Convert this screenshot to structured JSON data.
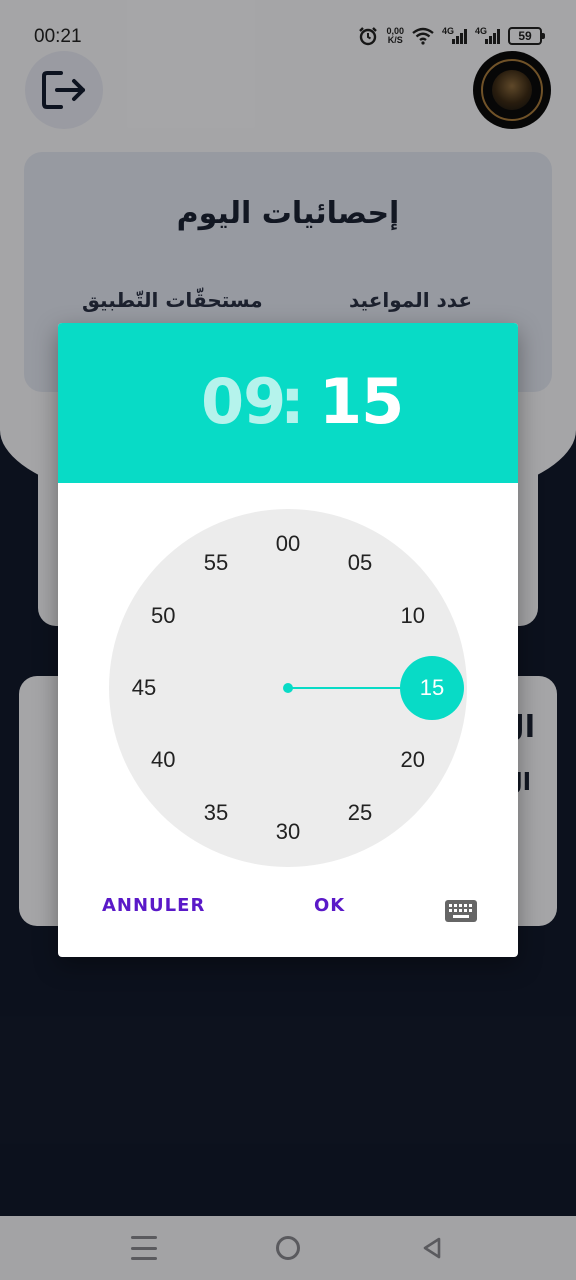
{
  "status_bar": {
    "time": "00:21",
    "net_speed_value": "0,00",
    "net_speed_unit": "K/S",
    "network_1": "4G",
    "network_2": "4G",
    "battery": "59",
    "icons": [
      "alarm-icon",
      "wifi-icon",
      "signal-icon",
      "signal-icon",
      "battery-icon"
    ]
  },
  "header": {
    "logout_icon": "logout-icon",
    "avatar_icon": "profile-avatar"
  },
  "stats_card": {
    "title": "إحصائيات اليوم",
    "label_appointments": "عدد المواعيد",
    "label_dues": "مستحقّات التّطبيق"
  },
  "card_c": {
    "char1": "ال",
    "char2": "ال"
  },
  "time_picker": {
    "hour": "09",
    "separator": ":",
    "minute": "15",
    "selected_minute": "15",
    "minutes": [
      "00",
      "05",
      "10",
      "15",
      "20",
      "25",
      "30",
      "35",
      "40",
      "45",
      "50",
      "55"
    ],
    "cancel_label": "ANNULER",
    "ok_label": "OK",
    "keyboard_icon": "keyboard-icon",
    "colors": {
      "accent": "#08dbc6",
      "button_text": "#5a19c8"
    }
  },
  "nav_bar": {
    "icons": [
      "menu-icon",
      "home-icon",
      "back-icon"
    ]
  }
}
